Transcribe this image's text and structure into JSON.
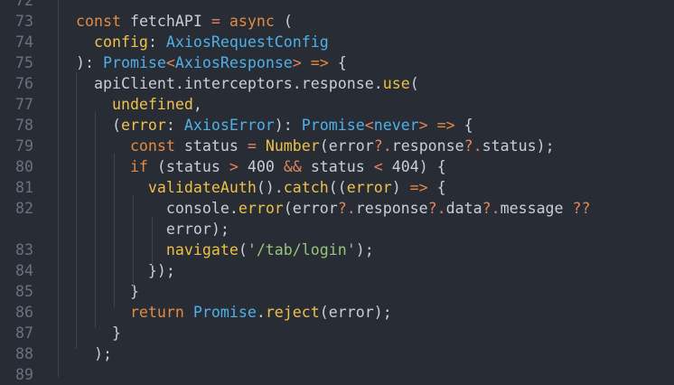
{
  "editor": {
    "background": "#282c34",
    "lines": [
      {
        "number": "72",
        "tokens": []
      },
      {
        "number": "73",
        "tokens": [
          {
            "t": "const ",
            "c": "kw"
          },
          {
            "t": "fetchAPI",
            "c": "pl"
          },
          {
            "t": " = ",
            "c": "op"
          },
          {
            "t": "async",
            "c": "kw"
          },
          {
            "t": " (",
            "c": "pl"
          }
        ]
      },
      {
        "number": "74",
        "tokens": [
          {
            "t": "  config",
            "c": "var"
          },
          {
            "t": ": ",
            "c": "pl"
          },
          {
            "t": "AxiosRequestConfig",
            "c": "ty"
          }
        ]
      },
      {
        "number": "75",
        "tokens": [
          {
            "t": "): ",
            "c": "pl"
          },
          {
            "t": "Promise",
            "c": "ty"
          },
          {
            "t": "<",
            "c": "op"
          },
          {
            "t": "AxiosResponse",
            "c": "ty"
          },
          {
            "t": "> ",
            "c": "op"
          },
          {
            "t": "=>",
            "c": "kw"
          },
          {
            "t": " {",
            "c": "pl"
          }
        ]
      },
      {
        "number": "76",
        "tokens": [
          {
            "t": "  apiClient",
            "c": "pl"
          },
          {
            "t": ".",
            "c": "pl"
          },
          {
            "t": "interceptors",
            "c": "pl"
          },
          {
            "t": ".",
            "c": "pl"
          },
          {
            "t": "response",
            "c": "pl"
          },
          {
            "t": ".",
            "c": "pl"
          },
          {
            "t": "use",
            "c": "fn"
          },
          {
            "t": "(",
            "c": "pl"
          }
        ]
      },
      {
        "number": "77",
        "tokens": [
          {
            "t": "    undefined",
            "c": "var"
          },
          {
            "t": ",",
            "c": "pl"
          }
        ]
      },
      {
        "number": "78",
        "tokens": [
          {
            "t": "    (",
            "c": "pl"
          },
          {
            "t": "error",
            "c": "var"
          },
          {
            "t": ": ",
            "c": "pl"
          },
          {
            "t": "AxiosError",
            "c": "ty"
          },
          {
            "t": "): ",
            "c": "pl"
          },
          {
            "t": "Promise",
            "c": "ty"
          },
          {
            "t": "<",
            "c": "op"
          },
          {
            "t": "never",
            "c": "ty"
          },
          {
            "t": "> ",
            "c": "op"
          },
          {
            "t": "=>",
            "c": "kw"
          },
          {
            "t": " {",
            "c": "pl"
          }
        ]
      },
      {
        "number": "79",
        "tokens": [
          {
            "t": "      const ",
            "c": "kw"
          },
          {
            "t": "status",
            "c": "pl"
          },
          {
            "t": " = ",
            "c": "op"
          },
          {
            "t": "Number",
            "c": "fn"
          },
          {
            "t": "(",
            "c": "pl"
          },
          {
            "t": "error",
            "c": "pl"
          },
          {
            "t": "?.",
            "c": "op"
          },
          {
            "t": "response",
            "c": "pl"
          },
          {
            "t": "?.",
            "c": "op"
          },
          {
            "t": "status",
            "c": "pl"
          },
          {
            "t": ");",
            "c": "pl"
          }
        ]
      },
      {
        "number": "80",
        "tokens": [
          {
            "t": "      if",
            "c": "kw"
          },
          {
            "t": " (",
            "c": "pl"
          },
          {
            "t": "status",
            "c": "pl"
          },
          {
            "t": " > ",
            "c": "op"
          },
          {
            "t": "400",
            "c": "pl"
          },
          {
            "t": " && ",
            "c": "op"
          },
          {
            "t": "status",
            "c": "pl"
          },
          {
            "t": " < ",
            "c": "op"
          },
          {
            "t": "404",
            "c": "pl"
          },
          {
            "t": ") {",
            "c": "pl"
          }
        ]
      },
      {
        "number": "81",
        "tokens": [
          {
            "t": "        validateAuth",
            "c": "fn"
          },
          {
            "t": "().",
            "c": "pl"
          },
          {
            "t": "catch",
            "c": "fn"
          },
          {
            "t": "((",
            "c": "pl"
          },
          {
            "t": "error",
            "c": "var"
          },
          {
            "t": ") ",
            "c": "pl"
          },
          {
            "t": "=>",
            "c": "kw"
          },
          {
            "t": " {",
            "c": "pl"
          }
        ]
      },
      {
        "number": "82",
        "tokens": [
          {
            "t": "          console",
            "c": "pl"
          },
          {
            "t": ".",
            "c": "pl"
          },
          {
            "t": "error",
            "c": "fn"
          },
          {
            "t": "(",
            "c": "pl"
          },
          {
            "t": "error",
            "c": "pl"
          },
          {
            "t": "?.",
            "c": "op"
          },
          {
            "t": "response",
            "c": "pl"
          },
          {
            "t": "?.",
            "c": "op"
          },
          {
            "t": "data",
            "c": "pl"
          },
          {
            "t": "?.",
            "c": "op"
          },
          {
            "t": "message",
            "c": "pl"
          },
          {
            "t": " ??",
            "c": "op"
          }
        ]
      },
      {
        "number": "",
        "tokens": [
          {
            "t": "          error",
            "c": "pl"
          },
          {
            "t": ");",
            "c": "pl"
          }
        ]
      },
      {
        "number": "83",
        "tokens": [
          {
            "t": "          navigate",
            "c": "fn"
          },
          {
            "t": "(",
            "c": "pl"
          },
          {
            "t": "'/tab/login'",
            "c": "str"
          },
          {
            "t": ");",
            "c": "pl"
          }
        ]
      },
      {
        "number": "84",
        "tokens": [
          {
            "t": "        });",
            "c": "pl"
          }
        ]
      },
      {
        "number": "85",
        "tokens": [
          {
            "t": "      }",
            "c": "pl"
          }
        ]
      },
      {
        "number": "86",
        "tokens": [
          {
            "t": "      return ",
            "c": "kw"
          },
          {
            "t": "Promise",
            "c": "ty"
          },
          {
            "t": ".",
            "c": "pl"
          },
          {
            "t": "reject",
            "c": "fn"
          },
          {
            "t": "(",
            "c": "pl"
          },
          {
            "t": "error",
            "c": "pl"
          },
          {
            "t": ");",
            "c": "pl"
          }
        ]
      },
      {
        "number": "87",
        "tokens": [
          {
            "t": "    }",
            "c": "pl"
          }
        ]
      },
      {
        "number": "88",
        "tokens": [
          {
            "t": "  );",
            "c": "pl"
          }
        ]
      },
      {
        "number": "89",
        "tokens": []
      }
    ]
  }
}
